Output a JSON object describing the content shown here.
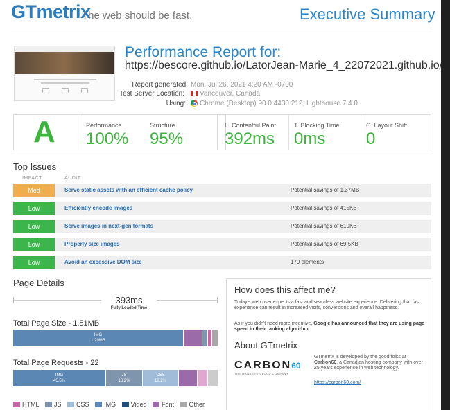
{
  "header": {
    "logo": "GTmetrix",
    "tagline": "The web should be fast.",
    "section": "Executive Summary"
  },
  "report": {
    "title": "Performance Report for:",
    "url": "https://bescore.github.io/LatorJean-Marie_4_22072021.github.io/",
    "generated_label": "Report generated:",
    "generated_value": "Mon, Jul 26, 2021 4:20 AM -0700",
    "location_label": "Test Server Location:",
    "location_value": "Vancouver, Canada",
    "using_label": "Using:",
    "using_value": "Chrome (Desktop) 90.0.4430.212, Lighthouse 7.4.0"
  },
  "grade": {
    "letter": "A",
    "performance_label": "Performance",
    "performance_value": "100%",
    "structure_label": "Structure",
    "structure_value": "95%"
  },
  "vitals": {
    "lcp_label": "L. Contentful Paint",
    "lcp_value": "392ms",
    "tbt_label": "T. Blocking Time",
    "tbt_value": "0ms",
    "cls_label": "C. Layout Shift",
    "cls_value": "0"
  },
  "top_issues": {
    "title": "Top Issues",
    "impact_header": "IMPACT",
    "audit_header": "AUDIT",
    "rows": [
      {
        "impact": "Med",
        "audit": "Serve static assets with an efficient cache policy",
        "note": "Potential savings of 1.37MB"
      },
      {
        "impact": "Low",
        "audit": "Efficiently encode images",
        "note": "Potential savings of 415KB"
      },
      {
        "impact": "Low",
        "audit": "Serve images in next-gen formats",
        "note": "Potential savings of 610KB"
      },
      {
        "impact": "Low",
        "audit": "Properly size images",
        "note": "Potential savings of 69.5KB"
      },
      {
        "impact": "Low",
        "audit": "Avoid an excessive DOM size",
        "note": "179 elements"
      }
    ]
  },
  "colors": {
    "med": "#f0ad4e",
    "low": "#3cb54a",
    "html": "#c86aa8",
    "js": "#7f95ad",
    "css": "#a0bcd8",
    "img": "#5b87b5",
    "video": "#1f4e79",
    "font": "#9b6aa8",
    "other": "#a8a8a8"
  },
  "page_details": {
    "title": "Page Details",
    "loaded_value": "393ms",
    "loaded_caption": "Fully Loaded Time",
    "size_title": "Total Page Size - 1.51MB",
    "size_img_label": "IMG",
    "size_img_value": "1.29MB",
    "requests_title": "Total Page Requests - 22",
    "req_img_label": "IMG",
    "req_img_value": "45.5%",
    "req_js_label": "JS",
    "req_js_value": "18.2%",
    "req_css_label": "CSS",
    "req_css_value": "18.2%"
  },
  "legend": [
    "HTML",
    "JS",
    "CSS",
    "IMG",
    "Video",
    "Font",
    "Other"
  ],
  "affect": {
    "title": "How does this affect me?",
    "p1": "Today's web user expects a fast and seamless website experience. Delivering that fast experience can result in increased visits, conversions and overall happiness.",
    "p2_start": "As if you didn't need more incentive, ",
    "p2_bold": "Google has announced that they are using page speed in their ranking algorithm.",
    "about_title": "About GTmetrix",
    "carbon_word": "CARBON",
    "carbon_num": "60",
    "carbon_tag": "THE MANAGED CLOUD COMPANY",
    "about_p_start": "GTmetrix is developed by the good folks at ",
    "about_p_bold": "Carbon60",
    "about_p_end": ", a Canadian hosting company with over 25 years experience in web technology.",
    "link": "https://carbon60.com/"
  }
}
